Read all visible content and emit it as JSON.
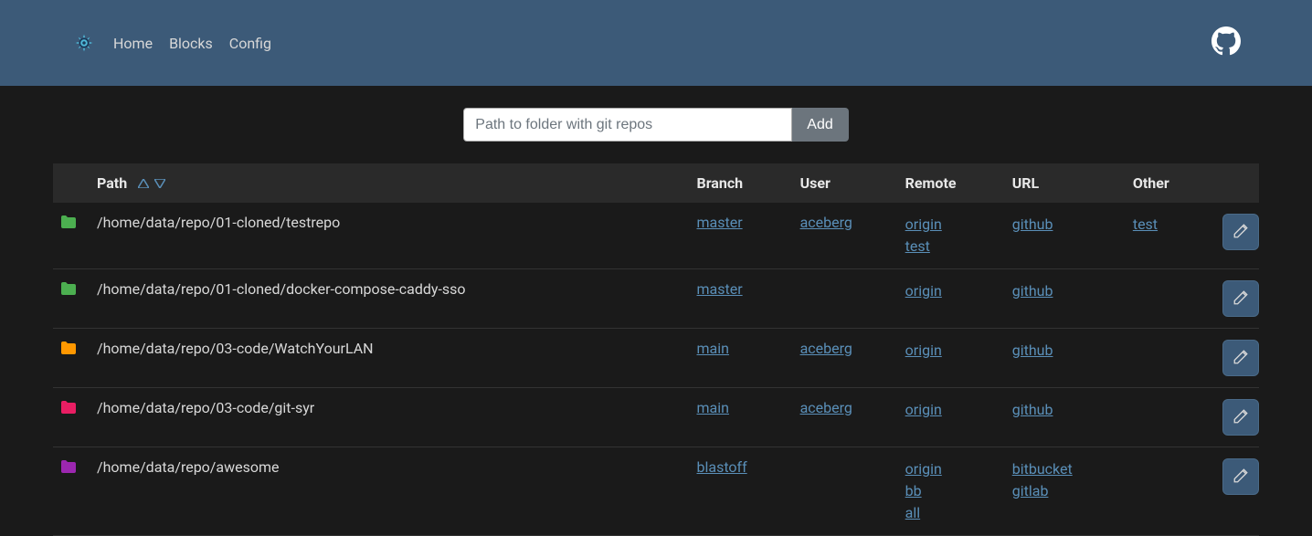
{
  "nav": {
    "home": "Home",
    "blocks": "Blocks",
    "config": "Config"
  },
  "add_form": {
    "path_placeholder": "Path to folder with git repos",
    "add_label": "Add"
  },
  "table": {
    "headers": {
      "path": "Path",
      "branch": "Branch",
      "user": "User",
      "remote": "Remote",
      "url": "URL",
      "other": "Other"
    },
    "rows": [
      {
        "icon_color": "#4caf50",
        "path": "/home/data/repo/01-cloned/testrepo",
        "branch": "master",
        "user": "aceberg",
        "remote": [
          "origin",
          "test"
        ],
        "url": [
          "github"
        ],
        "other": [
          "test"
        ]
      },
      {
        "icon_color": "#4caf50",
        "path": "/home/data/repo/01-cloned/docker-compose-caddy-sso",
        "branch": "master",
        "user": "",
        "remote": [
          "origin"
        ],
        "url": [
          "github"
        ],
        "other": []
      },
      {
        "icon_color": "#ff9800",
        "path": "/home/data/repo/03-code/WatchYourLAN",
        "branch": "main",
        "user": "aceberg",
        "remote": [
          "origin"
        ],
        "url": [
          "github"
        ],
        "other": []
      },
      {
        "icon_color": "#e91e63",
        "path": "/home/data/repo/03-code/git-syr",
        "branch": "main",
        "user": "aceberg",
        "remote": [
          "origin"
        ],
        "url": [
          "github"
        ],
        "other": []
      },
      {
        "icon_color": "#9c27b0",
        "path": "/home/data/repo/awesome",
        "branch": "blastoff",
        "user": "",
        "remote": [
          "origin",
          "bb",
          "all"
        ],
        "url": [
          "bitbucket",
          "gitlab"
        ],
        "other": []
      }
    ]
  }
}
